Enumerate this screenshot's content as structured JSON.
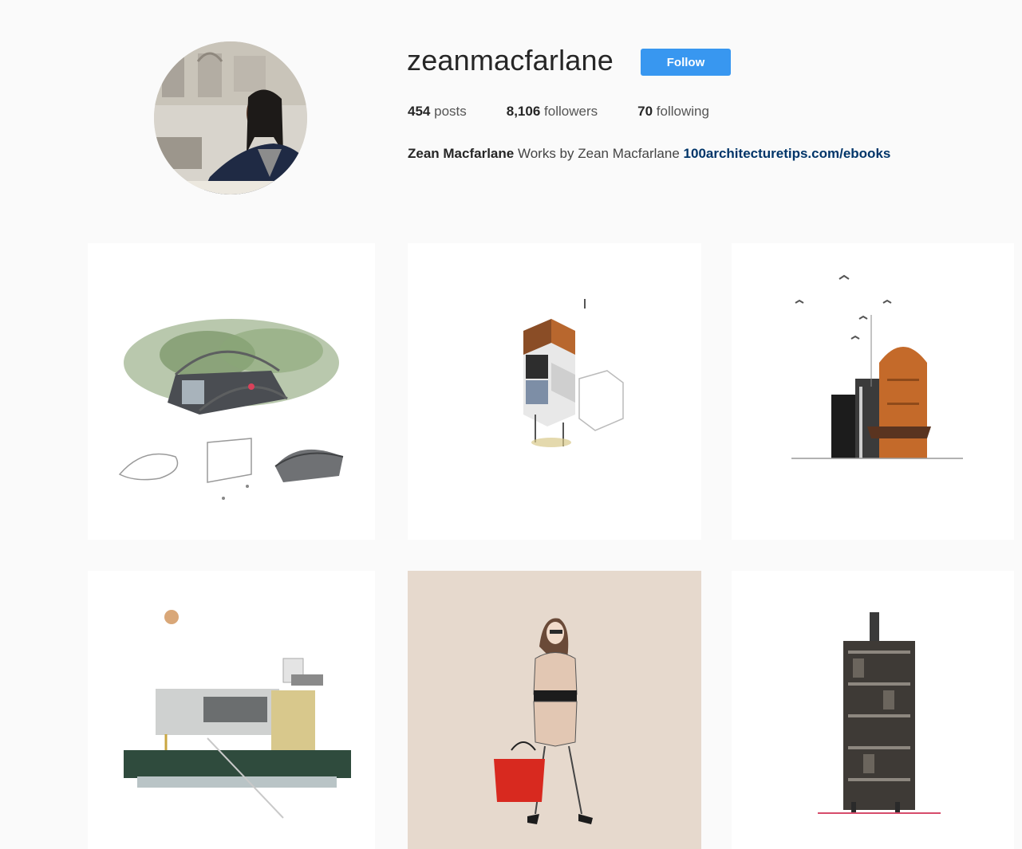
{
  "profile": {
    "username": "zeanmacfarlane",
    "follow_label": "Follow",
    "stats": {
      "posts_count": "454",
      "posts_label": "posts",
      "followers_count": "8,106",
      "followers_label": "followers",
      "following_count": "70",
      "following_label": "following"
    },
    "bio": {
      "full_name": "Zean Macfarlane",
      "text": "Works by Zean Macfarlane",
      "link": "100architecturetips.com/ebooks"
    }
  },
  "colors": {
    "follow_button": "#3897f0",
    "link": "#003569",
    "page_background": "#fafafa"
  },
  "posts": [
    {
      "name": "post-vine-covered-pavilion"
    },
    {
      "name": "post-isometric-tower"
    },
    {
      "name": "post-orange-arch-facade"
    },
    {
      "name": "post-modern-house-elevation"
    },
    {
      "name": "post-woman-red-bag"
    },
    {
      "name": "post-dark-tower-elevation"
    }
  ]
}
